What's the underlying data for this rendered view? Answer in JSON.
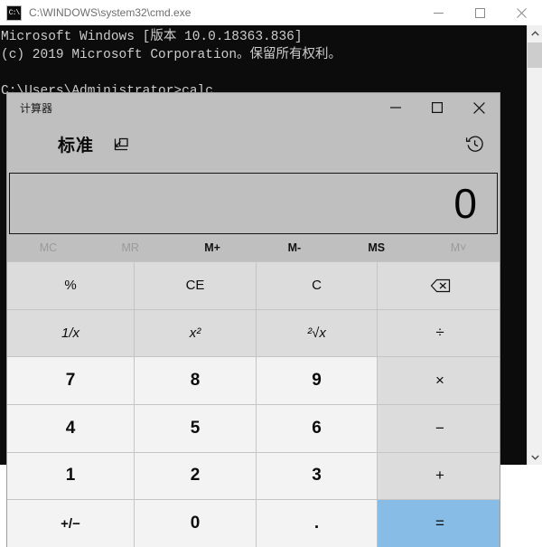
{
  "cmd_window": {
    "icon": "cmd-icon",
    "icon_text": "C:\\",
    "title": "C:\\WINDOWS\\system32\\cmd.exe",
    "controls": [
      {
        "name": "minimize-button",
        "icon": "minimize-icon"
      },
      {
        "name": "maximize-button",
        "icon": "maximize-icon"
      },
      {
        "name": "close-button",
        "icon": "close-icon"
      }
    ],
    "console_text": "Microsoft Windows [版本 10.0.18363.836]\n(c) 2019 Microsoft Corporation。保留所有权利。\n\nC:\\Users\\Administrator>calc",
    "scrollbar": {
      "up_arrow_icon": "chevron-up-icon",
      "down_arrow_icon": "chevron-down-icon"
    }
  },
  "calculator": {
    "title": "计算器",
    "controls": [
      {
        "name": "minimize-button",
        "icon": "minimize-icon"
      },
      {
        "name": "maximize-button",
        "icon": "maximize-icon"
      },
      {
        "name": "close-button",
        "icon": "close-icon"
      }
    ],
    "nav": {
      "menu_icon": "hamburger-menu-icon",
      "mode": "标准",
      "keep_on_top_icon": "keep-on-top-icon",
      "history_icon": "history-clock-icon"
    },
    "display": {
      "value": "0"
    },
    "memory": [
      {
        "label": "MC",
        "name": "memory-clear-button",
        "disabled": true
      },
      {
        "label": "MR",
        "name": "memory-recall-button",
        "disabled": true
      },
      {
        "label": "M+",
        "name": "memory-add-button",
        "disabled": false
      },
      {
        "label": "M-",
        "name": "memory-subtract-button",
        "disabled": false
      },
      {
        "label": "MS",
        "name": "memory-store-button",
        "disabled": false
      },
      {
        "label": "M˅",
        "name": "memory-list-button",
        "disabled": true
      }
    ],
    "keys": {
      "percent": "%",
      "clear_entry": "CE",
      "clear": "C",
      "backspace_icon": "backspace-icon",
      "reciprocal": "1/x",
      "square": "x²",
      "square_root": "²√x",
      "divide": "÷",
      "seven": "7",
      "eight": "8",
      "nine": "9",
      "multiply": "×",
      "four": "4",
      "five": "5",
      "six": "6",
      "subtract": "−",
      "one": "1",
      "two": "2",
      "three": "3",
      "add": "+",
      "plus_minus": "+/−",
      "zero": "0",
      "decimal": ".",
      "equals": "="
    },
    "colors": {
      "window_bg": "#bfbfbf",
      "number_key": "#f3f3f3",
      "function_key": "#dcdcdc",
      "equals_key": "#86bce5"
    }
  }
}
